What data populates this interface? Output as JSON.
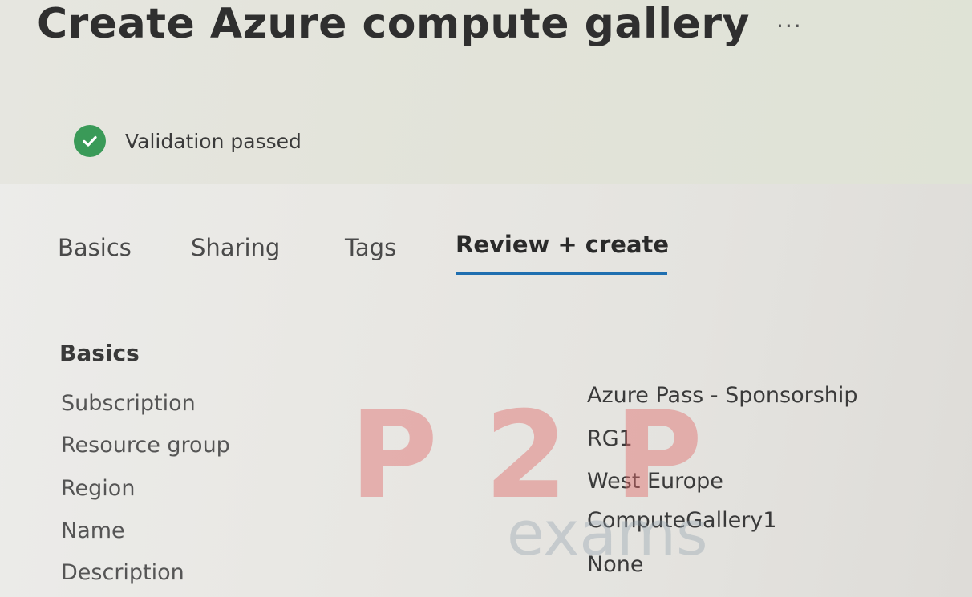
{
  "header": {
    "title": "Create Azure compute gallery",
    "more_icon": "ellipsis-icon",
    "more_label": "···"
  },
  "validation": {
    "icon": "check-circle-icon",
    "status_color": "#3a9a58",
    "message": "Validation passed"
  },
  "tabs": [
    {
      "label": "Basics",
      "active": false
    },
    {
      "label": "Sharing",
      "active": false
    },
    {
      "label": "Tags",
      "active": false
    },
    {
      "label": "Review + create",
      "active": true
    }
  ],
  "accent_color": "#1f6fb0",
  "summary": {
    "section_title": "Basics",
    "rows": [
      {
        "label": "Subscription",
        "value": "Azure Pass - Sponsorship"
      },
      {
        "label": "Resource group",
        "value": "RG1"
      },
      {
        "label": "Region",
        "value": "West Europe"
      },
      {
        "label": "Name",
        "value": "ComputeGallery1"
      },
      {
        "label": "Description",
        "value": "None"
      }
    ]
  },
  "watermark": {
    "text_top": "P2P",
    "text_bottom": "exams"
  }
}
